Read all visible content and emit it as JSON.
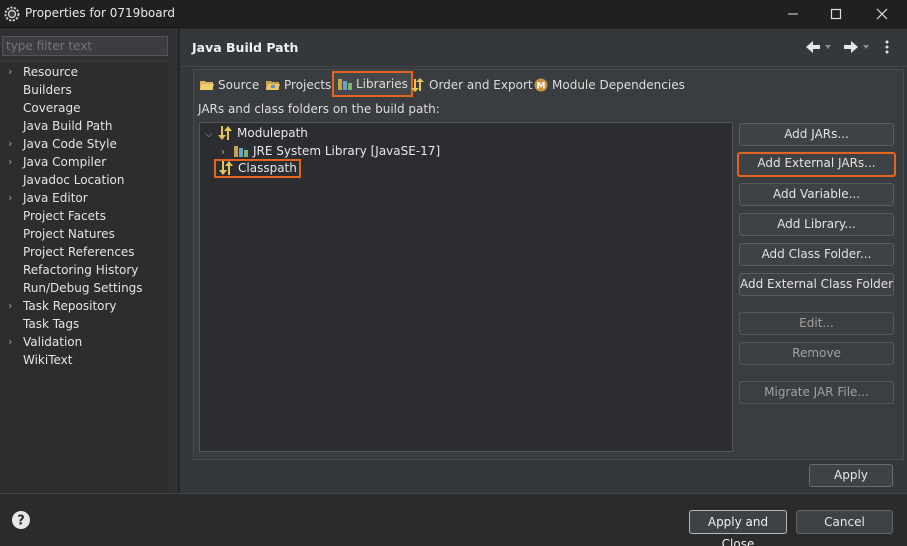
{
  "window": {
    "title": "Properties for 0719board"
  },
  "filter": {
    "placeholder": "type filter text"
  },
  "nav": {
    "items": [
      {
        "label": "Resource",
        "expandable": true
      },
      {
        "label": "Builders",
        "expandable": false
      },
      {
        "label": "Coverage",
        "expandable": false
      },
      {
        "label": "Java Build Path",
        "expandable": false
      },
      {
        "label": "Java Code Style",
        "expandable": true
      },
      {
        "label": "Java Compiler",
        "expandable": true
      },
      {
        "label": "Javadoc Location",
        "expandable": false
      },
      {
        "label": "Java Editor",
        "expandable": true
      },
      {
        "label": "Project Facets",
        "expandable": false
      },
      {
        "label": "Project Natures",
        "expandable": false
      },
      {
        "label": "Project References",
        "expandable": false
      },
      {
        "label": "Refactoring History",
        "expandable": false
      },
      {
        "label": "Run/Debug Settings",
        "expandable": false
      },
      {
        "label": "Task Repository",
        "expandable": true
      },
      {
        "label": "Task Tags",
        "expandable": false
      },
      {
        "label": "Validation",
        "expandable": true
      },
      {
        "label": "WikiText",
        "expandable": false
      }
    ]
  },
  "page": {
    "title": "Java Build Path"
  },
  "tabs": [
    {
      "label": "Source",
      "icon": "source-folder-icon"
    },
    {
      "label": "Projects",
      "icon": "projects-folder-icon"
    },
    {
      "label": "Libraries",
      "icon": "libraries-icon",
      "selected": true
    },
    {
      "label": "Order and Export",
      "icon": "order-export-icon"
    },
    {
      "label": "Module Dependencies",
      "icon": "module-icon"
    }
  ],
  "libraries": {
    "label": "JARs and class folders on the build path:",
    "tree": {
      "modulepath": "Modulepath",
      "jre": "JRE System Library [JavaSE-17]",
      "classpath": "Classpath"
    }
  },
  "buttons": {
    "add_jars": "Add JARs...",
    "add_external_jars": "Add External JARs...",
    "add_variable": "Add Variable...",
    "add_library": "Add Library...",
    "add_class_folder": "Add Class Folder...",
    "add_external_class_folder": "Add External Class Folder...",
    "edit": "Edit...",
    "remove": "Remove",
    "migrate_jar": "Migrate JAR File...",
    "apply": "Apply",
    "apply_and_close": "Apply and Close",
    "cancel": "Cancel"
  },
  "colors": {
    "highlight": "#e2641f",
    "background": "#35383b"
  }
}
